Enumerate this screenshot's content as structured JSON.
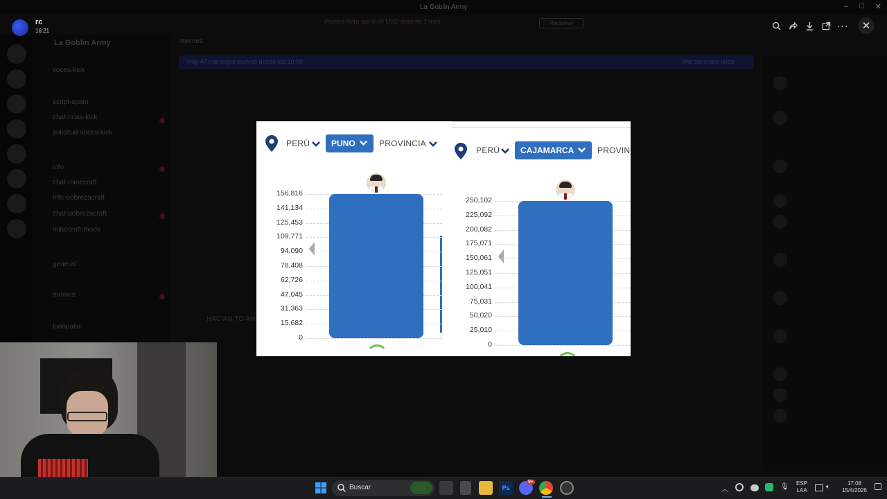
{
  "window": {
    "title": "La Goblin Army"
  },
  "account": {
    "name": "rc",
    "time": "16:21"
  },
  "discord": {
    "guild_name": "La Goblin Army",
    "channel_header": "memes",
    "channels": [
      "voces-kick",
      "script-spam",
      "chat-rinas-kick",
      "solicitud-voces-kick",
      "info",
      "chat-minecraft",
      "info-pobrezacraft",
      "chat-pobrezacraft",
      "minecraft-mods",
      "general",
      "memes",
      "ludopatia"
    ],
    "banner_text": "Hay 47 mensajes nuevos desde las 10:00",
    "banner_action": "Marcar como leído",
    "notice_text": "Prueba Nitro por 0,00 USD durante 1 mes",
    "notice_button": "Reclamar",
    "message_preview": "HACIAN TO AH"
  },
  "viewer": {
    "tools": [
      "zoom-icon",
      "share-icon",
      "download-icon",
      "open-icon",
      "more-icon"
    ],
    "close_label": "✕"
  },
  "panels": [
    {
      "country": "PERÚ",
      "region": "PUNO",
      "province": "PROVINCIA",
      "y_ticks": [
        "156,816",
        "141,134",
        "125,453",
        "109,771",
        "94,090",
        "78,408",
        "62,726",
        "47,045",
        "31,363",
        "15,682",
        "0"
      ]
    },
    {
      "country": "PERÚ",
      "region": "CAJAMARCA",
      "province": "PROVINCIA",
      "y_ticks": [
        "250,102",
        "225,092",
        "200,082",
        "175,071",
        "150,061",
        "125,051",
        "100,041",
        "75,031",
        "50,020",
        "25,010",
        "0"
      ]
    }
  ],
  "chart_data": [
    {
      "type": "bar",
      "categories": [
        "candidate"
      ],
      "values": [
        156816
      ],
      "ylim": [
        0,
        156816
      ],
      "yticks": [
        0,
        15682,
        31363,
        47045,
        62726,
        78408,
        94090,
        109771,
        125453,
        141134,
        156816
      ],
      "grid": true
    },
    {
      "type": "bar",
      "categories": [
        "candidate"
      ],
      "values": [
        250102
      ],
      "ylim": [
        0,
        250102
      ],
      "yticks": [
        0,
        25010,
        50020,
        75031,
        100041,
        125051,
        150061,
        175071,
        200082,
        225092,
        250102
      ],
      "grid": true
    }
  ],
  "taskbar": {
    "search_label": "Buscar",
    "lang_top": "ESP",
    "lang_bottom": "LAA",
    "time": "17:08",
    "date": "15/4/2026",
    "discord_badge": "9+"
  },
  "colors": {
    "bar": "#2f6fbf",
    "pill": "#2f6fbf",
    "pin": "#1d3f75",
    "accent": "#6bc24a"
  }
}
